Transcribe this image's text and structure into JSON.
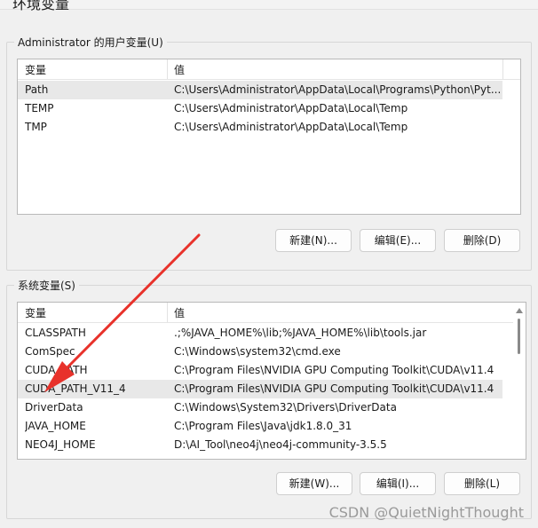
{
  "window": {
    "title": "环境变量"
  },
  "user_vars": {
    "group_label": "Administrator 的用户变量(U)",
    "col_name": "变量",
    "col_value": "值",
    "rows": [
      {
        "name": "Path",
        "value": "C:\\Users\\Administrator\\AppData\\Local\\Programs\\Python\\Pyt..."
      },
      {
        "name": "TEMP",
        "value": "C:\\Users\\Administrator\\AppData\\Local\\Temp"
      },
      {
        "name": "TMP",
        "value": "C:\\Users\\Administrator\\AppData\\Local\\Temp"
      }
    ],
    "selected_index": 0,
    "buttons": {
      "new": "新建(N)...",
      "edit": "编辑(E)...",
      "delete": "删除(D)"
    }
  },
  "system_vars": {
    "group_label": "系统变量(S)",
    "col_name": "变量",
    "col_value": "值",
    "rows": [
      {
        "name": "CLASSPATH",
        "value": ".;%JAVA_HOME%\\lib;%JAVA_HOME%\\lib\\tools.jar"
      },
      {
        "name": "ComSpec",
        "value": "C:\\Windows\\system32\\cmd.exe"
      },
      {
        "name": "CUDA_PATH",
        "value": "C:\\Program Files\\NVIDIA GPU Computing Toolkit\\CUDA\\v11.4"
      },
      {
        "name": "CUDA_PATH_V11_4",
        "value": "C:\\Program Files\\NVIDIA GPU Computing Toolkit\\CUDA\\v11.4"
      },
      {
        "name": "DriverData",
        "value": "C:\\Windows\\System32\\Drivers\\DriverData"
      },
      {
        "name": "JAVA_HOME",
        "value": "C:\\Program Files\\Java\\jdk1.8.0_31"
      },
      {
        "name": "NEO4J_HOME",
        "value": "D:\\AI_Tool\\neo4j\\neo4j-community-3.5.5"
      }
    ],
    "selected_index": 3,
    "buttons": {
      "new": "新建(W)...",
      "edit": "编辑(I)...",
      "delete": "删除(L)"
    }
  },
  "annotation": {
    "arrow_color": "#e8322b"
  },
  "watermark": "CSDN @QuietNightThought"
}
